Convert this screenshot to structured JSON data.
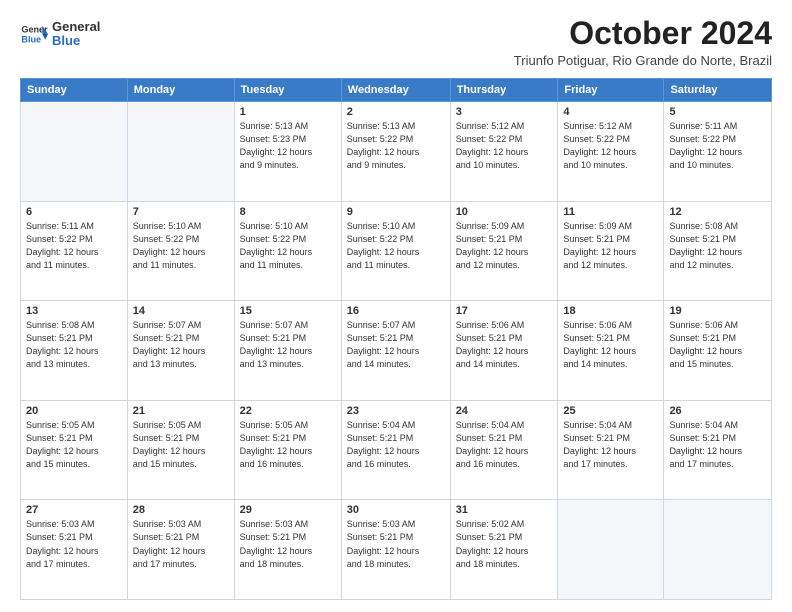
{
  "logo": {
    "general": "General",
    "blue": "Blue"
  },
  "header": {
    "month": "October 2024",
    "subtitle": "Triunfo Potiguar, Rio Grande do Norte, Brazil"
  },
  "weekdays": [
    "Sunday",
    "Monday",
    "Tuesday",
    "Wednesday",
    "Thursday",
    "Friday",
    "Saturday"
  ],
  "weeks": [
    [
      {
        "day": "",
        "detail": ""
      },
      {
        "day": "",
        "detail": ""
      },
      {
        "day": "1",
        "detail": "Sunrise: 5:13 AM\nSunset: 5:23 PM\nDaylight: 12 hours\nand 9 minutes."
      },
      {
        "day": "2",
        "detail": "Sunrise: 5:13 AM\nSunset: 5:22 PM\nDaylight: 12 hours\nand 9 minutes."
      },
      {
        "day": "3",
        "detail": "Sunrise: 5:12 AM\nSunset: 5:22 PM\nDaylight: 12 hours\nand 10 minutes."
      },
      {
        "day": "4",
        "detail": "Sunrise: 5:12 AM\nSunset: 5:22 PM\nDaylight: 12 hours\nand 10 minutes."
      },
      {
        "day": "5",
        "detail": "Sunrise: 5:11 AM\nSunset: 5:22 PM\nDaylight: 12 hours\nand 10 minutes."
      }
    ],
    [
      {
        "day": "6",
        "detail": "Sunrise: 5:11 AM\nSunset: 5:22 PM\nDaylight: 12 hours\nand 11 minutes."
      },
      {
        "day": "7",
        "detail": "Sunrise: 5:10 AM\nSunset: 5:22 PM\nDaylight: 12 hours\nand 11 minutes."
      },
      {
        "day": "8",
        "detail": "Sunrise: 5:10 AM\nSunset: 5:22 PM\nDaylight: 12 hours\nand 11 minutes."
      },
      {
        "day": "9",
        "detail": "Sunrise: 5:10 AM\nSunset: 5:22 PM\nDaylight: 12 hours\nand 11 minutes."
      },
      {
        "day": "10",
        "detail": "Sunrise: 5:09 AM\nSunset: 5:21 PM\nDaylight: 12 hours\nand 12 minutes."
      },
      {
        "day": "11",
        "detail": "Sunrise: 5:09 AM\nSunset: 5:21 PM\nDaylight: 12 hours\nand 12 minutes."
      },
      {
        "day": "12",
        "detail": "Sunrise: 5:08 AM\nSunset: 5:21 PM\nDaylight: 12 hours\nand 12 minutes."
      }
    ],
    [
      {
        "day": "13",
        "detail": "Sunrise: 5:08 AM\nSunset: 5:21 PM\nDaylight: 12 hours\nand 13 minutes."
      },
      {
        "day": "14",
        "detail": "Sunrise: 5:07 AM\nSunset: 5:21 PM\nDaylight: 12 hours\nand 13 minutes."
      },
      {
        "day": "15",
        "detail": "Sunrise: 5:07 AM\nSunset: 5:21 PM\nDaylight: 12 hours\nand 13 minutes."
      },
      {
        "day": "16",
        "detail": "Sunrise: 5:07 AM\nSunset: 5:21 PM\nDaylight: 12 hours\nand 14 minutes."
      },
      {
        "day": "17",
        "detail": "Sunrise: 5:06 AM\nSunset: 5:21 PM\nDaylight: 12 hours\nand 14 minutes."
      },
      {
        "day": "18",
        "detail": "Sunrise: 5:06 AM\nSunset: 5:21 PM\nDaylight: 12 hours\nand 14 minutes."
      },
      {
        "day": "19",
        "detail": "Sunrise: 5:06 AM\nSunset: 5:21 PM\nDaylight: 12 hours\nand 15 minutes."
      }
    ],
    [
      {
        "day": "20",
        "detail": "Sunrise: 5:05 AM\nSunset: 5:21 PM\nDaylight: 12 hours\nand 15 minutes."
      },
      {
        "day": "21",
        "detail": "Sunrise: 5:05 AM\nSunset: 5:21 PM\nDaylight: 12 hours\nand 15 minutes."
      },
      {
        "day": "22",
        "detail": "Sunrise: 5:05 AM\nSunset: 5:21 PM\nDaylight: 12 hours\nand 16 minutes."
      },
      {
        "day": "23",
        "detail": "Sunrise: 5:04 AM\nSunset: 5:21 PM\nDaylight: 12 hours\nand 16 minutes."
      },
      {
        "day": "24",
        "detail": "Sunrise: 5:04 AM\nSunset: 5:21 PM\nDaylight: 12 hours\nand 16 minutes."
      },
      {
        "day": "25",
        "detail": "Sunrise: 5:04 AM\nSunset: 5:21 PM\nDaylight: 12 hours\nand 17 minutes."
      },
      {
        "day": "26",
        "detail": "Sunrise: 5:04 AM\nSunset: 5:21 PM\nDaylight: 12 hours\nand 17 minutes."
      }
    ],
    [
      {
        "day": "27",
        "detail": "Sunrise: 5:03 AM\nSunset: 5:21 PM\nDaylight: 12 hours\nand 17 minutes."
      },
      {
        "day": "28",
        "detail": "Sunrise: 5:03 AM\nSunset: 5:21 PM\nDaylight: 12 hours\nand 17 minutes."
      },
      {
        "day": "29",
        "detail": "Sunrise: 5:03 AM\nSunset: 5:21 PM\nDaylight: 12 hours\nand 18 minutes."
      },
      {
        "day": "30",
        "detail": "Sunrise: 5:03 AM\nSunset: 5:21 PM\nDaylight: 12 hours\nand 18 minutes."
      },
      {
        "day": "31",
        "detail": "Sunrise: 5:02 AM\nSunset: 5:21 PM\nDaylight: 12 hours\nand 18 minutes."
      },
      {
        "day": "",
        "detail": ""
      },
      {
        "day": "",
        "detail": ""
      }
    ]
  ]
}
